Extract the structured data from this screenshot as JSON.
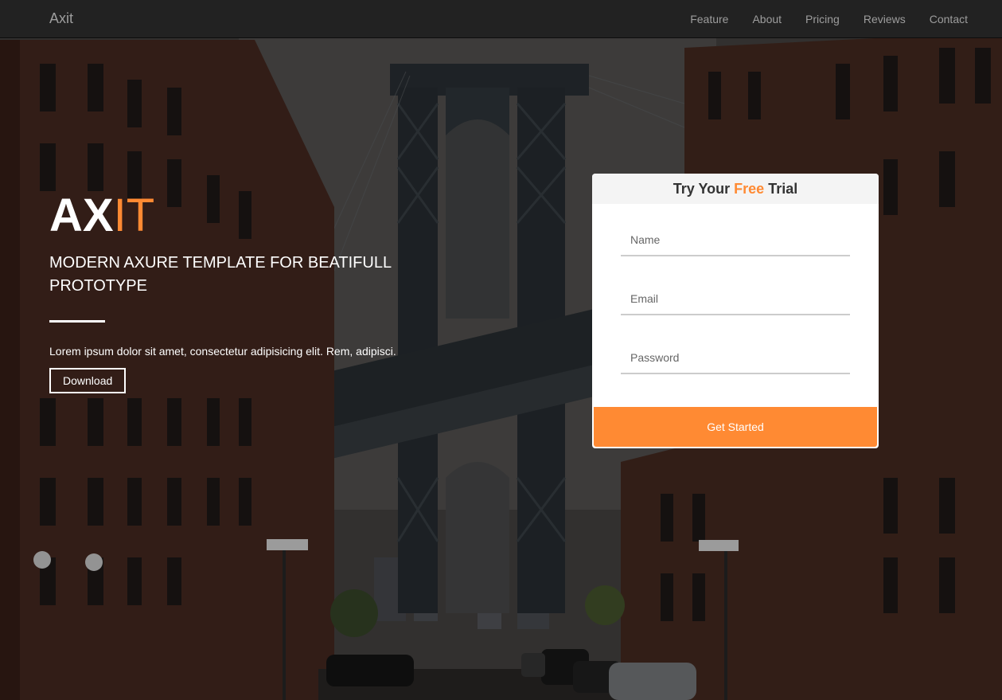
{
  "navbar": {
    "brand": "Axit",
    "links": [
      "Feature",
      "About",
      "Pricing",
      "Reviews",
      "Contact"
    ]
  },
  "hero": {
    "title_part1": "AX",
    "title_part2": "IT",
    "subtitle": "MODERN AXURE TEMPLATE FOR BEATIFULL PROTOTYPE",
    "description": "Lorem ipsum dolor sit amet, consectetur adipisicing elit. Rem, adipisci.",
    "download_label": "Download"
  },
  "trial_form": {
    "title_prefix": "Try Your",
    "title_highlight": "Free",
    "title_suffix": "Trial",
    "name_placeholder": "Name",
    "email_placeholder": "Email",
    "password_placeholder": "Password",
    "submit_label": "Get Started"
  },
  "colors": {
    "accent": "#ff8a33",
    "navbar_bg": "#222222",
    "navbar_text": "#9d9d9d"
  }
}
